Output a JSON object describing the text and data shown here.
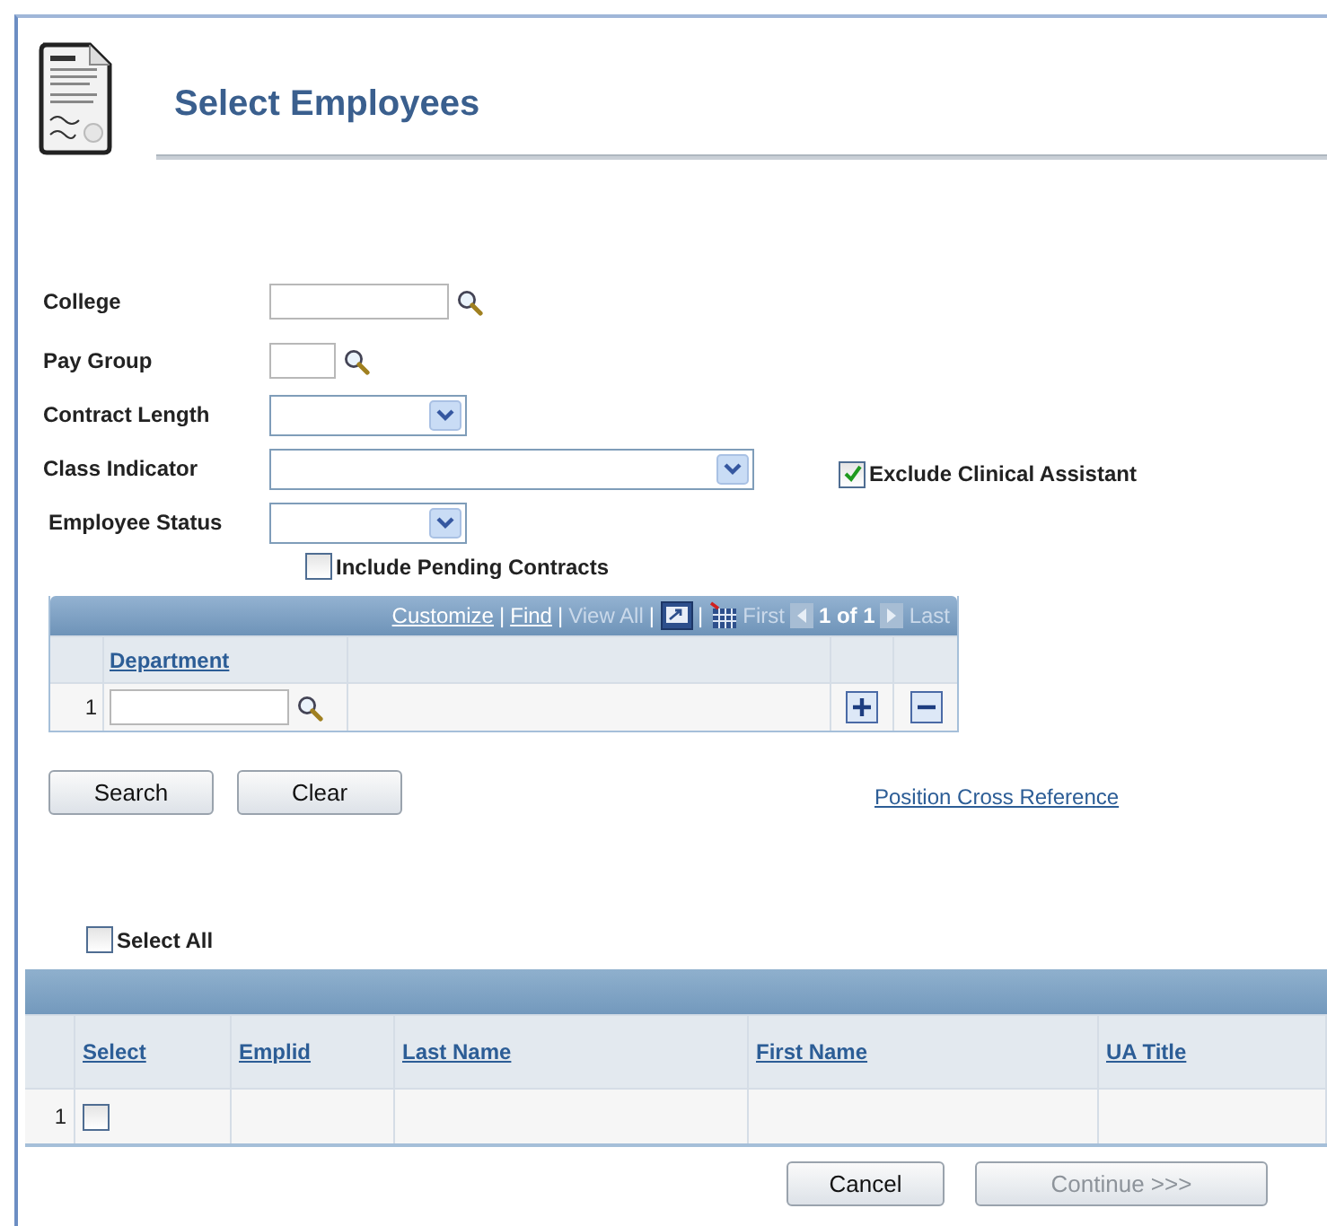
{
  "page": {
    "title": "Select Employees"
  },
  "fields": [
    {
      "label": "College",
      "kind": "lookup"
    },
    {
      "label": "Pay Group",
      "kind": "lookup"
    },
    {
      "label": "Contract Length",
      "kind": "dropdown"
    },
    {
      "label": "Class Indicator",
      "kind": "dropdown",
      "option": {
        "label": "Exclude Clinical Assistant",
        "checked": true
      }
    },
    {
      "label": "Employee Status",
      "kind": "dropdown"
    }
  ],
  "pending": {
    "label": "Include Pending Contracts",
    "checked": false
  },
  "department_grid": {
    "toolbar": [
      {
        "text": "Customize",
        "kind": "link",
        "disabled": false
      },
      {
        "text": "|",
        "kind": "separator"
      },
      {
        "text": "Find",
        "kind": "link",
        "disabled": false
      },
      {
        "text": "|",
        "kind": "separator"
      },
      {
        "text": "View All",
        "kind": "link",
        "disabled": true
      },
      {
        "text": "|",
        "kind": "separator"
      },
      {
        "kind": "new_window"
      },
      {
        "text": "|",
        "kind": "separator"
      },
      {
        "kind": "grid"
      }
    ],
    "first": "First",
    "page": "1 of 1",
    "last": "Last",
    "column": "Department",
    "rows": [
      {
        "number": "1"
      }
    ]
  },
  "actions": [
    {
      "label": "Search"
    },
    {
      "label": "Clear"
    }
  ],
  "link": "Position Cross Reference",
  "select_all": {
    "label": "Select All",
    "checked": false
  },
  "results": {
    "columns": [
      "Select",
      "Emplid",
      "Last Name",
      "First Name",
      "UA Title"
    ],
    "rows": [
      {
        "number": "1",
        "selected": false
      }
    ]
  },
  "footer_buttons": [
    {
      "label": "Cancel",
      "disabled": false
    },
    {
      "label": "Continue >>>",
      "disabled": true
    }
  ]
}
